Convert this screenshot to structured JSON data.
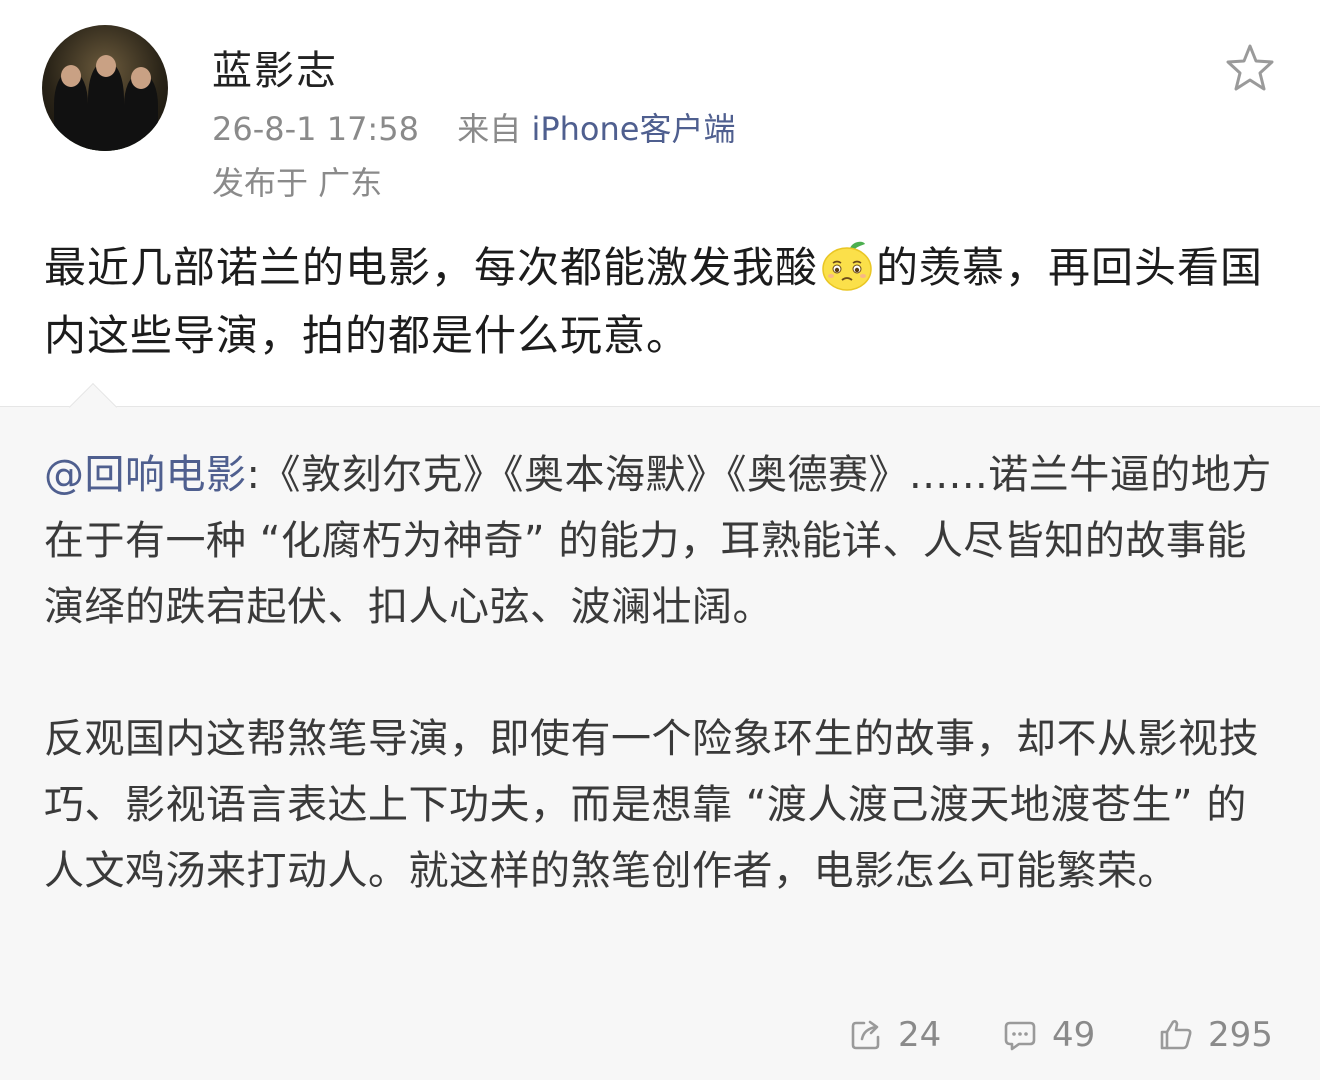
{
  "post": {
    "username": "蓝影志",
    "date": "26-8-1 17:58",
    "from_prefix": "来自",
    "source": "iPhone客户端",
    "location": "发布于 广东",
    "text_part1": "最近几部诺兰的电影，每次都能激发我酸",
    "emoji": "lemon-sour-face",
    "text_part2": "的羡慕，再回头看国内这些导演，拍的都是什么玩意。"
  },
  "repost": {
    "mention": "@回响电影",
    "paragraph1": ":《敦刻尔克》《奥本海默》《奥德赛》......诺兰牛逼的地方在于有一种 “化腐朽为神奇” 的能力，耳熟能详、人尽皆知的故事能演绎的跌宕起伏、扣人心弦、波澜壮阔。",
    "paragraph2": "反观国内这帮煞笔导演，即使有一个险象环生的故事，却不从影视技巧、影视语言表达上下功夫，而是想靠 “渡人渡己渡天地渡苍生” 的人文鸡汤来打动人。就这样的煞笔创作者，电影怎么可能繁荣。"
  },
  "actions": {
    "repost_count": "24",
    "comment_count": "49",
    "like_count": "295"
  },
  "colors": {
    "link": "#4f5f8f",
    "meta": "#8a8a8a",
    "repost_bg": "#f7f7f7"
  }
}
